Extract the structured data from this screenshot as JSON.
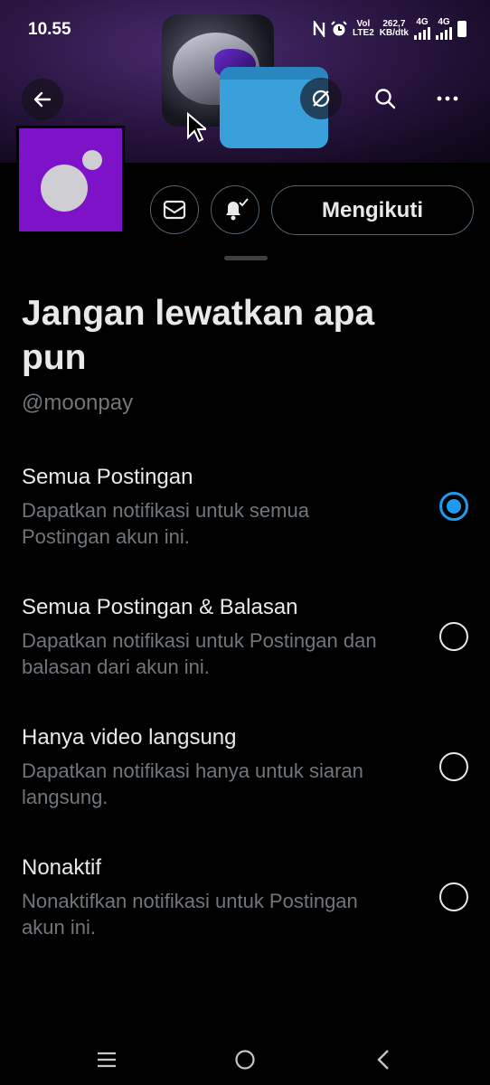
{
  "status_bar": {
    "time": "10.55",
    "network_top": "Vol",
    "network_bottom": "LTE2",
    "speed_top": "262,7",
    "speed_bottom": "KB/dtk",
    "net1": "4G",
    "net2": "4G",
    "icons": [
      "nfc-icon",
      "alarm-icon",
      "signal-icon",
      "signal-icon",
      "battery-icon"
    ]
  },
  "header": {
    "icons": [
      "back-arrow-icon",
      "sync-icon",
      "search-icon",
      "more-icon"
    ]
  },
  "profile": {
    "follow_label": "Mengikuti",
    "icons": [
      "mail-icon",
      "bell-check-icon"
    ],
    "avatar_color": "#7d12c9"
  },
  "sheet": {
    "title": "Jangan lewatkan apa pun",
    "handle": "@moonpay",
    "options": [
      {
        "title": "Semua Postingan",
        "desc": "Dapatkan notifikasi untuk semua Postingan akun ini.",
        "selected": true
      },
      {
        "title": "Semua Postingan & Balasan",
        "desc": "Dapatkan notifikasi untuk Postingan dan balasan dari akun ini.",
        "selected": false
      },
      {
        "title": "Hanya video langsung",
        "desc": "Dapatkan notifikasi hanya untuk siaran langsung.",
        "selected": false
      },
      {
        "title": "Nonaktif",
        "desc": "Nonaktifkan notifikasi untuk Postingan akun ini.",
        "selected": false
      }
    ]
  },
  "nav": {
    "icons": [
      "menu-icon",
      "home-icon",
      "back-icon"
    ]
  },
  "colors": {
    "accent": "#1d9bf0",
    "background": "#000000",
    "text_secondary": "#71767b"
  }
}
